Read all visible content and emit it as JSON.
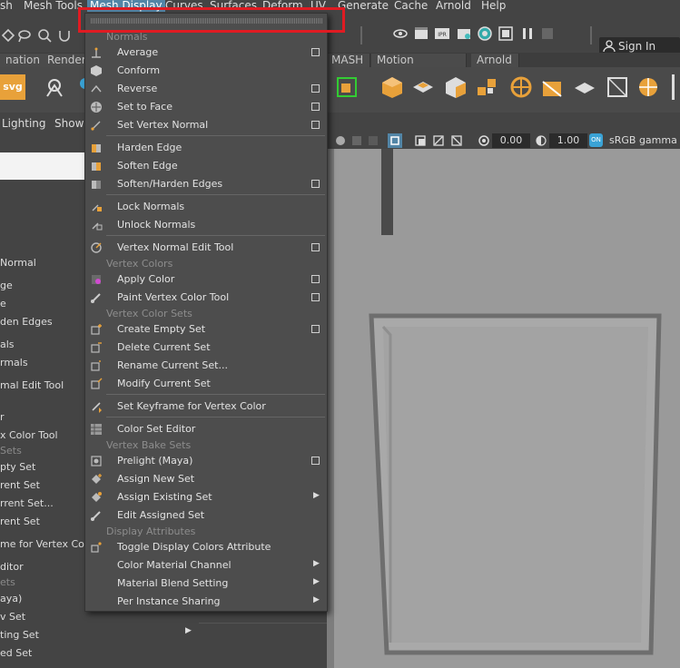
{
  "menubar": {
    "items": [
      {
        "label": "sh"
      },
      {
        "label": "Mesh Tools"
      },
      {
        "label": "Mesh Display"
      },
      {
        "label": "Curves"
      },
      {
        "label": "Surfaces"
      },
      {
        "label": "Deform"
      },
      {
        "label": "UV"
      },
      {
        "label": "Generate"
      },
      {
        "label": "Cache"
      },
      {
        "label": "Arnold"
      },
      {
        "label": "Help"
      }
    ]
  },
  "statusline": {
    "sign_in": "Sign In"
  },
  "shelf": {
    "tabs": [
      "nation",
      "Renderi",
      "MASH",
      "Motion Graphics",
      "Arnold"
    ],
    "svg_label": "svg"
  },
  "panel": {
    "menu_lighting": "Lighting",
    "menu_show": "Show",
    "exposure": "0.00",
    "gamma": "1.00",
    "colorspace": "sRGB gamma"
  },
  "left_panel": {
    "items": [
      "Normal",
      "ge",
      "e",
      "den Edges",
      "als",
      "rmals",
      "mal Edit Tool",
      "r",
      "x Color Tool",
      "Sets",
      "pty Set",
      "rent Set",
      "rrent Set...",
      "rent Set",
      "me for Vertex Color",
      "ditor",
      "ets",
      "aya)",
      "v Set",
      "ting Set",
      "ed Set"
    ]
  },
  "menu": {
    "sections": {
      "normals": "Normals",
      "vertex_colors": "Vertex Colors",
      "vertex_color_sets": "Vertex Color Sets",
      "vertex_bake_sets": "Vertex Bake Sets",
      "display_attributes": "Display Attributes"
    },
    "items": {
      "average": "Average",
      "conform": "Conform",
      "reverse": "Reverse",
      "set_to_face": "Set to Face",
      "set_vertex_normal": "Set Vertex Normal",
      "harden_edge": "Harden Edge",
      "soften_edge": "Soften Edge",
      "soften_harden_edges": "Soften/Harden Edges",
      "lock_normals": "Lock Normals",
      "unlock_normals": "Unlock Normals",
      "vertex_normal_edit_tool": "Vertex Normal Edit Tool",
      "apply_color": "Apply Color",
      "paint_vertex_color_tool": "Paint Vertex Color Tool",
      "create_empty_set": "Create Empty Set",
      "delete_current_set": "Delete Current Set",
      "rename_current_set": "Rename Current Set...",
      "modify_current_set": "Modify Current Set",
      "set_keyframe_vertex_color": "Set Keyframe for Vertex Color",
      "color_set_editor": "Color Set Editor",
      "prelight_maya": "Prelight (Maya)",
      "assign_new_set": "Assign New Set",
      "assign_existing_set": "Assign Existing Set",
      "edit_assigned_set": "Edit Assigned Set",
      "toggle_display_colors": "Toggle Display Colors Attribute",
      "color_material_channel": "Color Material Channel",
      "material_blend_setting": "Material Blend Setting",
      "per_instance_sharing": "Per Instance Sharing"
    }
  },
  "colors": {
    "highlight": "#e01b22",
    "menu_active": "#5285a6",
    "shelf_orange": "#e8a13a"
  }
}
